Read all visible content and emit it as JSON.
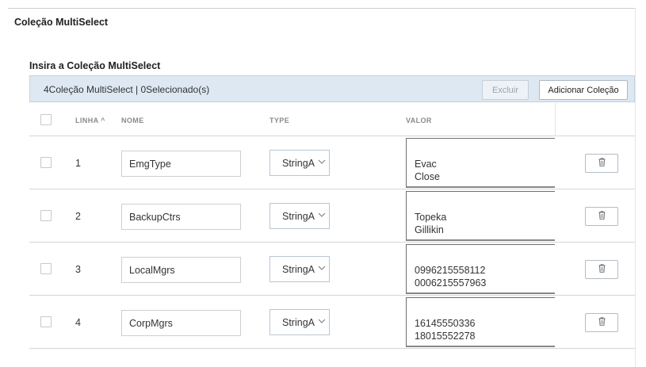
{
  "section": {
    "title": "Coleção MultiSelect"
  },
  "panel": {
    "title": "Insira a Coleção MultiSelect"
  },
  "toolbar": {
    "summary": "4Coleção MultiSelect | 0Selecionado(s)",
    "delete_label": "Excluir",
    "add_label": "Adicionar Coleção"
  },
  "columns": {
    "linha": "LINHA ^",
    "nome": "NOME",
    "type": "TYPE",
    "valor": "VALOR"
  },
  "rows": [
    {
      "num": "1",
      "name": "EmgType",
      "type": "StringA",
      "values": [
        "Evac",
        "Close"
      ]
    },
    {
      "num": "2",
      "name": "BackupCtrs",
      "type": "StringA",
      "values": [
        "Topeka",
        "Gillikin"
      ]
    },
    {
      "num": "3",
      "name": "LocalMgrs",
      "type": "StringA",
      "values": [
        "0996215558112",
        "0006215557963"
      ]
    },
    {
      "num": "4",
      "name": "CorpMgrs",
      "type": "StringA",
      "values": [
        "16145550336",
        "18015552278"
      ]
    }
  ],
  "icons": {
    "select_chevron": "chevron-down-icon",
    "delete": "trash-icon"
  }
}
